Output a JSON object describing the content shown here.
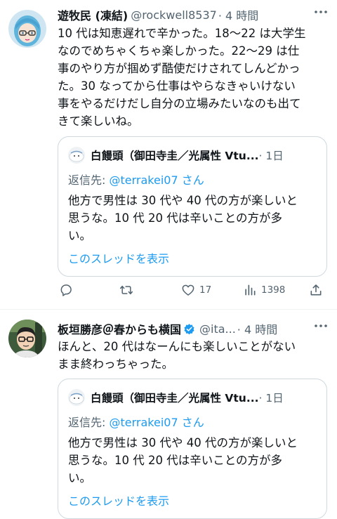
{
  "tweets": [
    {
      "display_name": "遊牧民 (凍結)",
      "handle": "@rockwell8537",
      "time": "· 4 時間",
      "text": "10 代は知恵遅れで辛かった。18〜22 は大学生\nなのでめちゃくちゃ楽しかった。22〜29 は仕\n事のやり方が掴めず酷使だけされてしんどかっ\nた。30 なってから仕事はやらなきゃいけない\n事をやるだけだし自分の立場みたいなのも出て\nきて楽しいね。",
      "quote": {
        "name": "白饅頭（御田寺圭／光属性 Vtu...",
        "time": "· 1日",
        "reply_prefix": "返信先: ",
        "reply_mention": "@terrakei07 さん",
        "text": "他方で男性は 30 代や 40 代の方が楽しいと\n思うな。10 代 20 代は辛いことの方が多\nい。",
        "show_thread": "このスレッドを表示"
      },
      "actions": {
        "reply": "",
        "retweet": "",
        "like": "17",
        "views": "1398"
      }
    },
    {
      "display_name": "板垣勝彦＠春からも横国",
      "handle": "@ita...",
      "time": "· 4 時間",
      "verified": true,
      "text": "ほんと、20 代はなーんにも楽しいことがない\nまま終わっちゃった。",
      "quote": {
        "name": "白饅頭（御田寺圭／光属性 Vtu...",
        "time": "· 1日",
        "reply_prefix": "返信先: ",
        "reply_mention": "@terrakei07 さん",
        "text": "他方で男性は 30 代や 40 代の方が楽しいと\n思うな。10 代 20 代は辛いことの方が多\nい。",
        "show_thread": "このスレッドを表示"
      }
    }
  ],
  "colors": {
    "accent": "#1d9bf0",
    "muted": "#536471",
    "text": "#0f1419",
    "border": "#cfd9de"
  }
}
